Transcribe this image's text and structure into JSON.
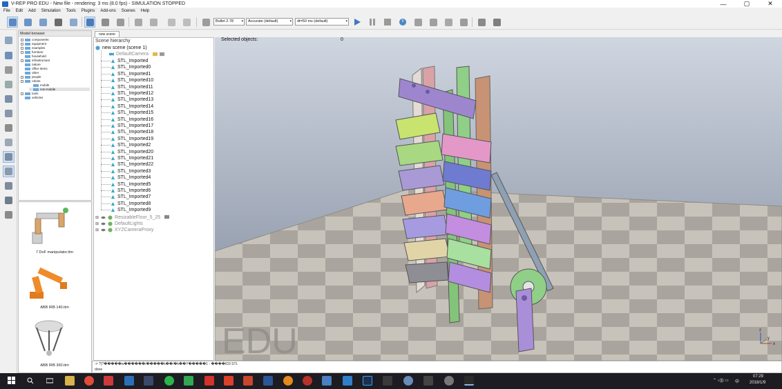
{
  "window": {
    "title": "V-REP PRO EDU - New file - rendering: 3 ms (8.0 fps) - SIMULATION STOPPED",
    "minimize": "—",
    "maximize": "▢",
    "close": "✕"
  },
  "menu": [
    "File",
    "Edit",
    "Add",
    "Simulation",
    "Tools",
    "Plugins",
    "Add-ons",
    "Scenes",
    "Help"
  ],
  "toolbar": {
    "physics_engine": "Bullet 2.78",
    "accuracy": "Accurate (default)",
    "timestep": "dt=50 ms (default)"
  },
  "model_browser": {
    "title": "Model browser",
    "items": [
      {
        "label": "components",
        "indent": 0,
        "expand": true
      },
      {
        "label": "equipment",
        "indent": 0,
        "expand": true
      },
      {
        "label": "examples",
        "indent": 0,
        "expand": true
      },
      {
        "label": "furniture",
        "indent": 0,
        "expand": true
      },
      {
        "label": "household",
        "indent": 0,
        "expand": false
      },
      {
        "label": "infrastructure",
        "indent": 0,
        "expand": true
      },
      {
        "label": "nature",
        "indent": 0,
        "expand": false
      },
      {
        "label": "office items",
        "indent": 0,
        "expand": false
      },
      {
        "label": "other",
        "indent": 0,
        "expand": false
      },
      {
        "label": "people",
        "indent": 0,
        "expand": true
      },
      {
        "label": "robots",
        "indent": 0,
        "expand": true
      },
      {
        "label": "mobile",
        "indent": 1,
        "expand": false
      },
      {
        "label": "non-mobile",
        "indent": 1,
        "expand": false,
        "selected": true
      },
      {
        "label": "tools",
        "indent": 0,
        "expand": true
      },
      {
        "label": "vehicles",
        "indent": 0,
        "expand": false
      }
    ],
    "thumbnails": [
      "7 DoF manipulator.ttm",
      "ABB IRB 140.ttm",
      "ABB IRB 360.ttm"
    ]
  },
  "scene": {
    "tab": "new scene",
    "hierarchy_title": "Scene hierarchy",
    "root": "new scene (scene 1)",
    "camera": "DefaultCamera",
    "imported": [
      "STL_Imported",
      "STL_Imported0",
      "STL_Imported1",
      "STL_Imported10",
      "STL_Imported11",
      "STL_Imported12",
      "STL_Imported13",
      "STL_Imported14",
      "STL_Imported15",
      "STL_Imported16",
      "STL_Imported17",
      "STL_Imported18",
      "STL_Imported19",
      "STL_Imported2",
      "STL_Imported20",
      "STL_Imported21",
      "STL_Imported22",
      "STL_Imported3",
      "STL_Imported4",
      "STL_Imported5",
      "STL_Imported6",
      "STL_Imported7",
      "STL_Imported8",
      "STL_Imported9"
    ],
    "others": [
      "ResizableFloor_5_25",
      "DefaultLights",
      "XYZCameraProxy"
    ]
  },
  "viewport": {
    "selected_label": "Selected objects:",
    "selected_count": "0",
    "watermark": "EDU",
    "axis_x": "x",
    "axis_y": "y",
    "axis_z": "z"
  },
  "console": {
    "line1": "-> ?(?�����w������/�����k��/�k��Y�����1 - ����ID3 STL",
    "line2": "done"
  },
  "taskbar": {
    "clock_time": "07:29",
    "clock_date": "2018/1/9",
    "ime": "中",
    "colors": {
      "bg": "#1c1c22"
    }
  },
  "colors": {
    "sky_top": "#c7cfda",
    "sky_bottom": "#8a94a7",
    "floor_a": "#c9c4bb",
    "floor_b": "#a7a39c",
    "accent": "#2f6db5"
  }
}
